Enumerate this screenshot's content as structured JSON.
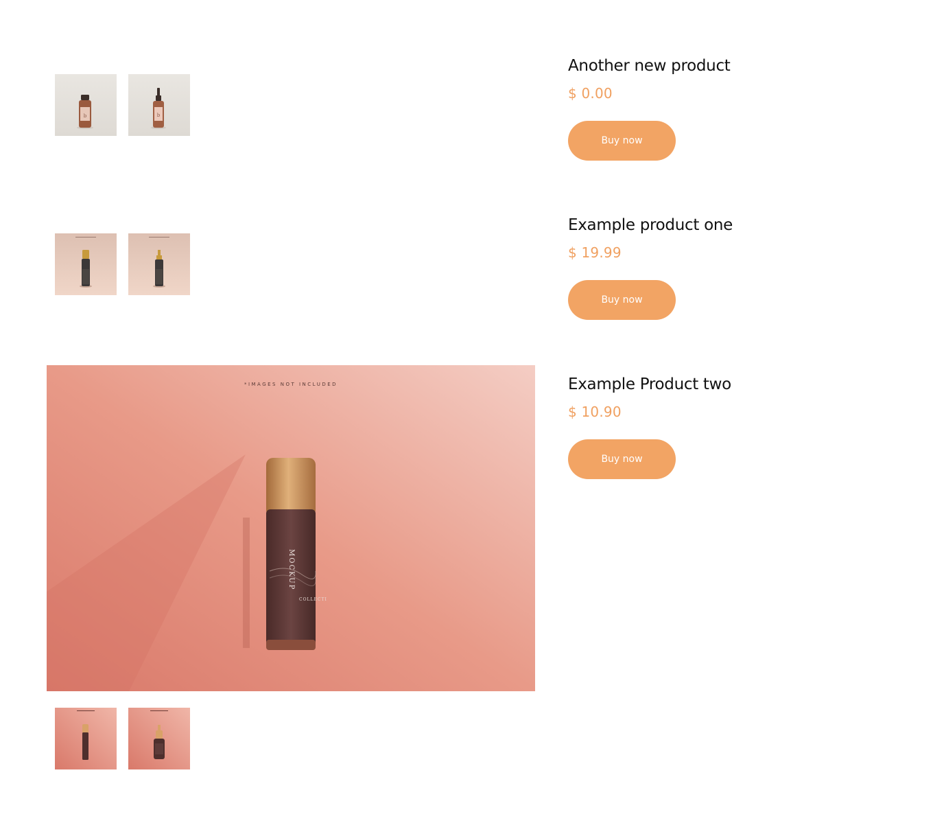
{
  "products": [
    {
      "title": "Another new product",
      "price": "$ 0.00",
      "buy_label": "Buy now"
    },
    {
      "title": "Example product one",
      "price": "$ 19.99",
      "buy_label": "Buy now"
    },
    {
      "title": "Example Product two",
      "price": "$ 10.90",
      "buy_label": "Buy now"
    }
  ],
  "main_image": {
    "caption": "*IMAGES NOT INCLUDED",
    "brand_text": "MOCKUP",
    "sub_text": "COLLECTI"
  },
  "colors": {
    "accent": "#f2a464",
    "price": "#f0a060",
    "title": "#111111"
  }
}
